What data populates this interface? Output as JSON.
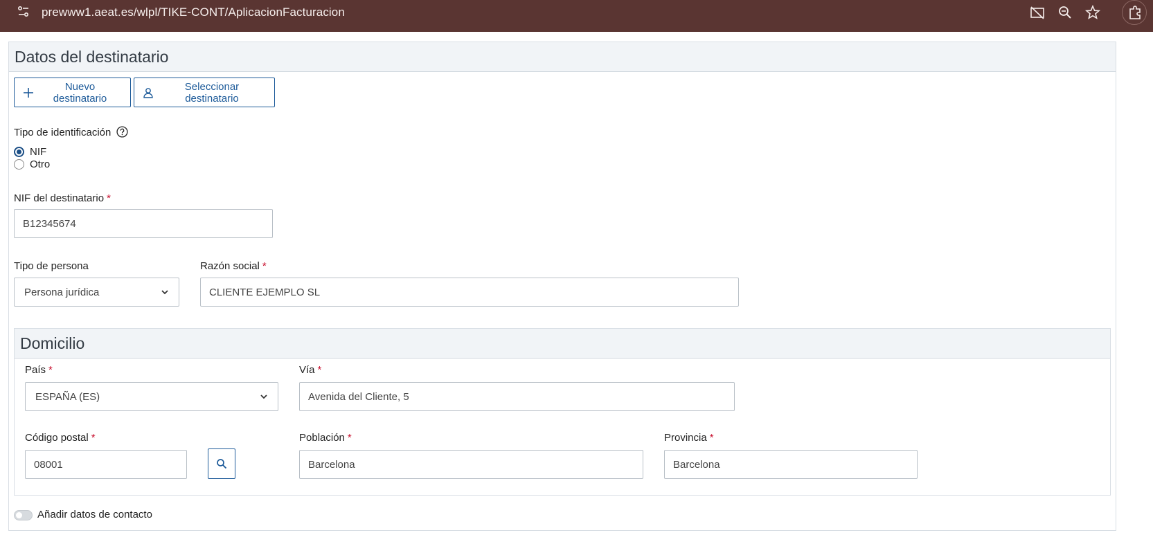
{
  "browser": {
    "url": "prewww1.aeat.es/wlpl/TIKE-CONT/AplicacionFacturacion"
  },
  "section": {
    "title": "Datos del destinatario",
    "new_button": "Nuevo destinatario",
    "select_button": "Seleccionar destinatario"
  },
  "identification": {
    "label": "Tipo de identificación",
    "options": [
      "NIF",
      "Otro"
    ],
    "selected": "NIF"
  },
  "nif": {
    "label": "NIF del destinatario",
    "required_mark": "*",
    "value": "B12345674"
  },
  "person_type": {
    "label": "Tipo de persona",
    "value": "Persona jurídica"
  },
  "company_name": {
    "label": "Razón social",
    "required_mark": "*",
    "value": "CLIENTE EJEMPLO SL"
  },
  "address": {
    "title": "Domicilio",
    "country": {
      "label": "País",
      "required_mark": "*",
      "value": "ESPAÑA (ES)"
    },
    "street": {
      "label": "Vía",
      "required_mark": "*",
      "value": "Avenida del Cliente, 5"
    },
    "postal_code": {
      "label": "Código postal",
      "required_mark": "*",
      "value": "08001"
    },
    "city": {
      "label": "Población",
      "required_mark": "*",
      "value": "Barcelona"
    },
    "province": {
      "label": "Provincia",
      "required_mark": "*",
      "value": "Barcelona"
    }
  },
  "contact": {
    "toggle_label": "Añadir datos de contacto",
    "enabled": false
  },
  "colors": {
    "browser_bar": "#5a3532",
    "accent": "#1c5a99",
    "required": "#c8102e",
    "header_bg": "#f1f4f7"
  },
  "icons": [
    "site-info-icon",
    "camera-off-icon",
    "zoom-icon",
    "star-icon",
    "extensions-icon",
    "plus-icon",
    "user-icon",
    "help-icon",
    "chevron-down-icon",
    "search-icon"
  ]
}
